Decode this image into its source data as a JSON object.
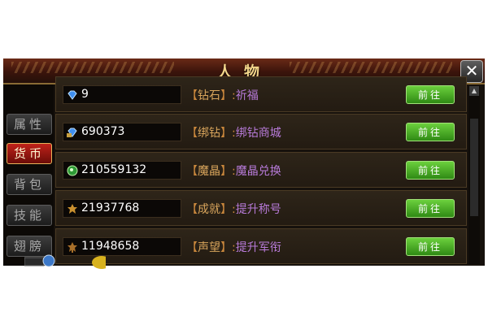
{
  "window": {
    "title": "人物",
    "close_icon": "close-icon"
  },
  "sidebar": {
    "tabs": [
      {
        "label": "属性",
        "active": false
      },
      {
        "label": "货币",
        "active": true
      },
      {
        "label": "背包",
        "active": false
      },
      {
        "label": "技能",
        "active": false
      },
      {
        "label": "翅膀",
        "active": false
      }
    ]
  },
  "currencies": [
    {
      "icon": "diamond-icon",
      "value": "9",
      "name": "钻石",
      "link": "祈福",
      "button": "前往"
    },
    {
      "icon": "bound-diamond-icon",
      "value": "690373",
      "name": "绑钻",
      "link": "绑钻商城",
      "button": "前往"
    },
    {
      "icon": "magic-crystal-icon",
      "value": "210559132",
      "name": "魔晶",
      "link": "魔晶兑换",
      "button": "前往"
    },
    {
      "icon": "achievement-icon",
      "value": "21937768",
      "name": "成就",
      "link": "提升称号",
      "button": "前往"
    },
    {
      "icon": "prestige-icon",
      "value": "11948658",
      "name": "声望",
      "link": "提升军衔",
      "button": "前往"
    }
  ],
  "colors": {
    "accent_green": "#3fae1c",
    "label_gold": "#c9873c",
    "link_purple": "#b77ad8"
  }
}
